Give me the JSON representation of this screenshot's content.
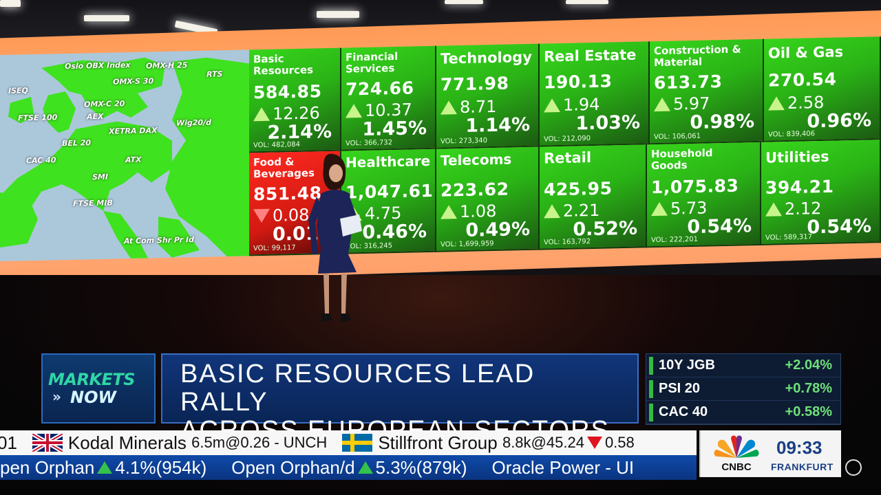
{
  "map": {
    "labels": [
      {
        "text": "Oslo OBX Index"
      },
      {
        "text": "OMX-H 25"
      },
      {
        "text": "OMX-S 30"
      },
      {
        "text": "RTS"
      },
      {
        "text": "ISEQ"
      },
      {
        "text": "OMX-C 20"
      },
      {
        "text": "FTSE 100"
      },
      {
        "text": "AEX"
      },
      {
        "text": "XETRA DAX"
      },
      {
        "text": "Wig20/d"
      },
      {
        "text": "BEL 20"
      },
      {
        "text": "CAC 40"
      },
      {
        "text": "ATX"
      },
      {
        "text": "SMI"
      },
      {
        "text": "FTSE MIB"
      },
      {
        "text": "At Com Shr Pr Id"
      }
    ]
  },
  "sectors": [
    {
      "name": "Basic Resources",
      "value": "584.85",
      "change": "12.26",
      "pct": "2.14%",
      "vol": "VOL: 482,084",
      "dir": "up"
    },
    {
      "name": "Financial Services",
      "value": "724.66",
      "change": "10.37",
      "pct": "1.45%",
      "vol": "VOL: 366,732",
      "dir": "up"
    },
    {
      "name": "Technology",
      "value": "771.98",
      "change": "8.71",
      "pct": "1.14%",
      "vol": "VOL: 273,340",
      "dir": "up"
    },
    {
      "name": "Real Estate",
      "value": "190.13",
      "change": "1.94",
      "pct": "1.03%",
      "vol": "VOL: 212,090",
      "dir": "up"
    },
    {
      "name": "Construction & Material",
      "value": "613.73",
      "change": "5.97",
      "pct": "0.98%",
      "vol": "VOL: 106,061",
      "dir": "up"
    },
    {
      "name": "Oil & Gas",
      "value": "270.54",
      "change": "2.58",
      "pct": "0.96%",
      "vol": "VOL: 839,406",
      "dir": "up"
    },
    {
      "name": "Food & Beverages",
      "value": "851.48",
      "change": "0.08",
      "pct": "0.01",
      "vol": "VOL: 99,117",
      "dir": "down"
    },
    {
      "name": "Healthcare",
      "value": "1,047.61",
      "change": "4.75",
      "pct": "0.46%",
      "vol": "VOL: 316,245",
      "dir": "up"
    },
    {
      "name": "Telecoms",
      "value": "223.62",
      "change": "1.08",
      "pct": "0.49%",
      "vol": "VOL: 1,699,959",
      "dir": "up"
    },
    {
      "name": "Retail",
      "value": "425.95",
      "change": "2.21",
      "pct": "0.52%",
      "vol": "VOL: 163,792",
      "dir": "up"
    },
    {
      "name": "Household Goods",
      "value": "1,075.83",
      "change": "5.73",
      "pct": "0.54%",
      "vol": "VOL: 222,201",
      "dir": "up"
    },
    {
      "name": "Utilities",
      "value": "394.21",
      "change": "2.12",
      "pct": "0.54%",
      "vol": "VOL: 589,317",
      "dir": "up"
    }
  ],
  "lower_third": {
    "brand_line1": "MARKETS",
    "brand_line2": "NOW",
    "headline_line1": "BASIC RESOURCES LEAD RALLY",
    "headline_line2": "ACROSS EUROPEAN SECTORS"
  },
  "markets": [
    {
      "name": "10Y JGB",
      "value": "+2.04%"
    },
    {
      "name": "PSI 20",
      "value": "+0.78%"
    },
    {
      "name": "CAC 40",
      "value": "+0.58%"
    }
  ],
  "ticker_top": {
    "lead": "01",
    "item1_name": "Kodal Minerals",
    "item1_quote": "6.5m@0.26 - UNCH",
    "item2_name": "Stillfront Group",
    "item2_quote": "8.8k@45.24",
    "item2_tail": "0.58"
  },
  "ticker_bottom": {
    "item1_name": "pen Orphan",
    "item1_quote": "4.1%(954k)",
    "item2_name": "Open Orphan/d",
    "item2_quote": "5.3%(879k)",
    "item3_name": "Oracle Power - UI"
  },
  "clock": {
    "brand": "CNBC",
    "time": "09:33",
    "city": "FRANKFURT"
  },
  "colors": {
    "tile_green": "#2ab316",
    "tile_red": "#d31a12",
    "headline_blue": "#11357a",
    "positive": "#6fe07a"
  }
}
